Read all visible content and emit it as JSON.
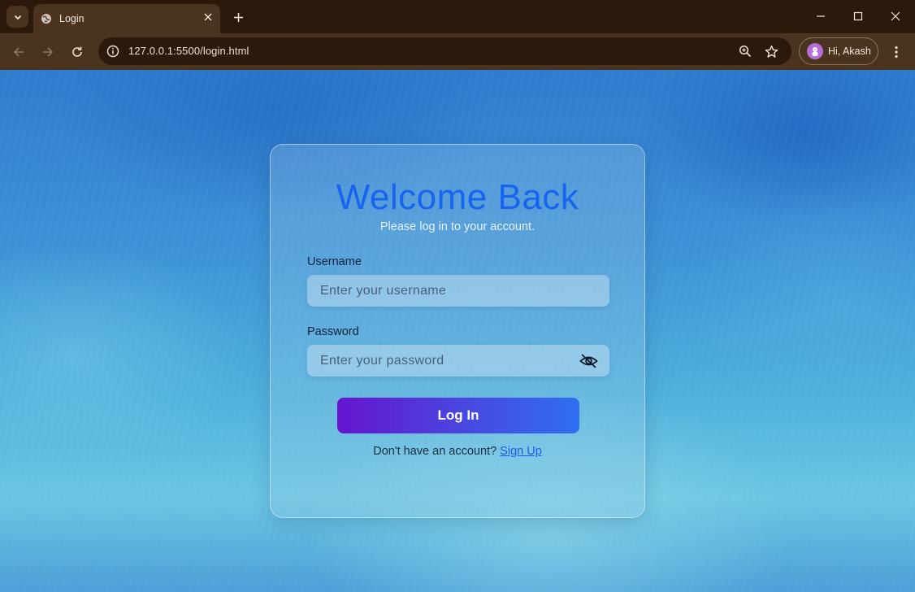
{
  "browser": {
    "tab_title": "Login",
    "url": "127.0.0.1:5500/login.html",
    "profile_greeting": "Hi, Akash",
    "icons": [
      "tab-list-icon",
      "globe-icon",
      "close-icon",
      "plus-icon",
      "minimize-icon",
      "maximize-icon",
      "close-window-icon",
      "back-arrow-icon",
      "forward-arrow-icon",
      "reload-icon",
      "site-info-icon",
      "zoom-icon",
      "star-icon",
      "avatar-icon",
      "more-vert-icon"
    ]
  },
  "login": {
    "title": "Welcome Back",
    "subtitle": "Please log in to your account.",
    "username_label": "Username",
    "username_placeholder": "Enter your username",
    "password_label": "Password",
    "password_placeholder": "Enter your password",
    "login_button": "Log In",
    "signup_prompt": "Don't have an account?",
    "signup_link": "Sign Up",
    "colors": {
      "title": "#1664f0",
      "button_start": "#6514cf",
      "button_end": "#2f6ff0",
      "link": "#1c5be8"
    }
  }
}
